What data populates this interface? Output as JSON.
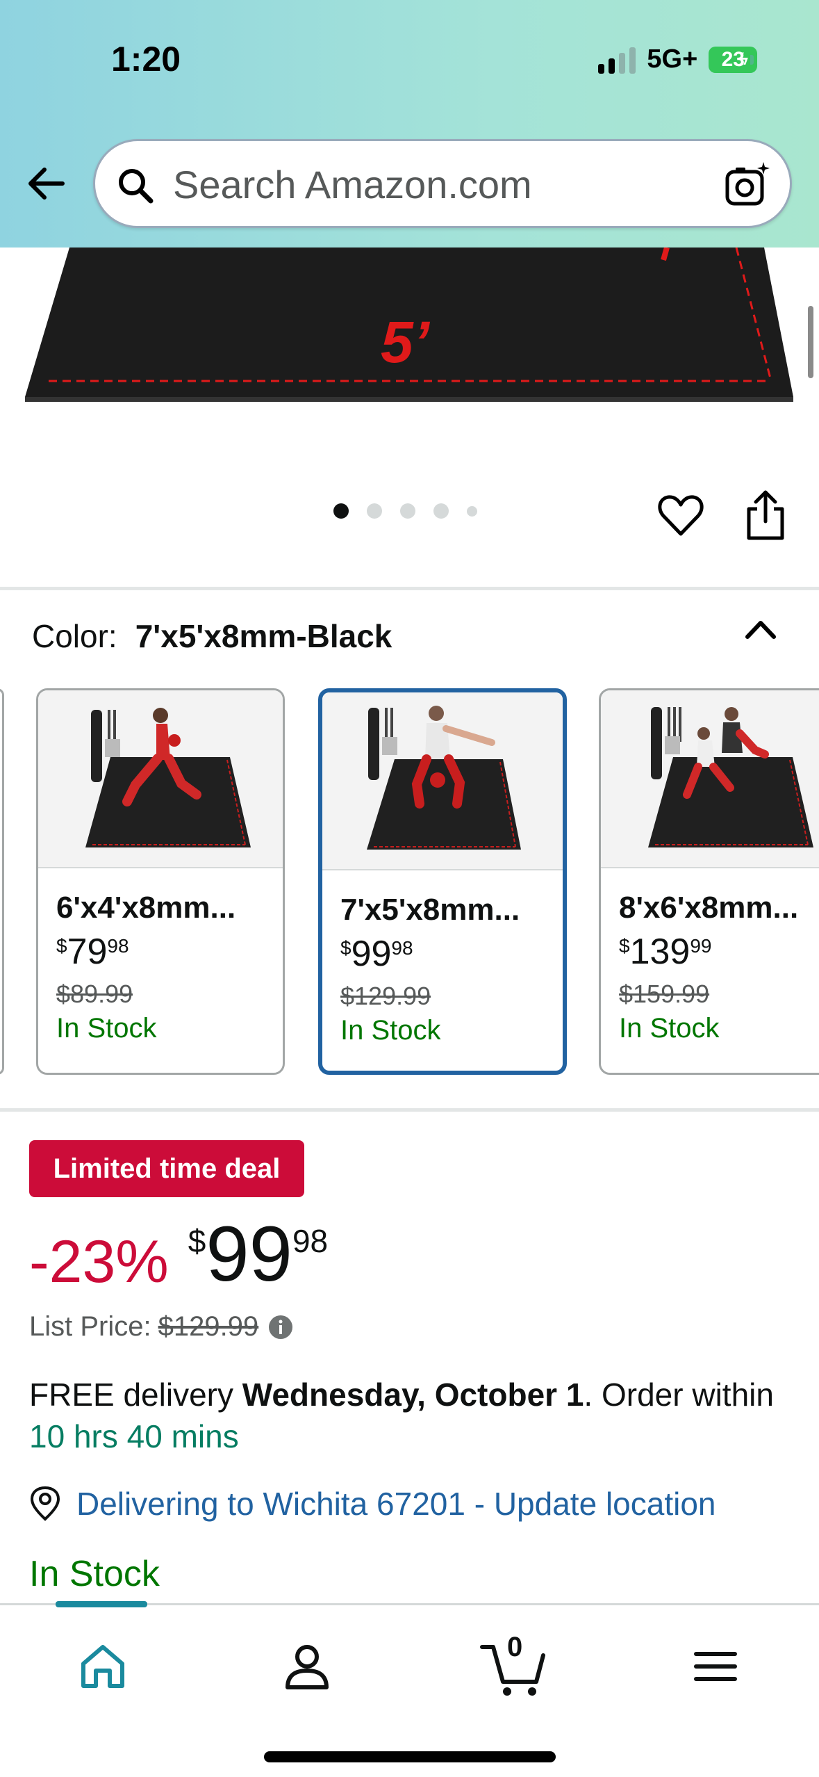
{
  "status_bar": {
    "time": "1:20",
    "network": "5G+",
    "battery": "23"
  },
  "search": {
    "placeholder": "Search Amazon.com"
  },
  "product_image": {
    "dimension_label": "5’"
  },
  "carousel": {
    "dot_count": 5,
    "active_index": 0
  },
  "color": {
    "label": "Color:",
    "value": "7'x5'x8mm-Black"
  },
  "variants": [
    {
      "title": "6'x4'x8mm...",
      "currency": "$",
      "price_whole": "79",
      "price_cents": "98",
      "list_price": "$89.99",
      "stock": "In Stock",
      "selected": false
    },
    {
      "title": "7'x5'x8mm...",
      "currency": "$",
      "price_whole": "99",
      "price_cents": "98",
      "list_price": "$129.99",
      "stock": "In Stock",
      "selected": true
    },
    {
      "title": "8'x6'x8mm...",
      "currency": "$",
      "price_whole": "139",
      "price_cents": "99",
      "list_price": "$159.99",
      "stock": "In Stock",
      "selected": false
    }
  ],
  "deal": {
    "badge": "Limited time deal",
    "discount": "-23%",
    "currency": "$",
    "price_whole": "99",
    "price_cents": "98",
    "list_price_label": "List Price:",
    "list_price": "$129.99"
  },
  "delivery": {
    "prefix": "FREE delivery ",
    "date": "Wednesday, October 1",
    "middle": ". Order within ",
    "countdown": "10 hrs 40 mins"
  },
  "location": {
    "link": "Delivering to Wichita 67201 - Update location"
  },
  "availability": "In Stock",
  "cart": {
    "count": "0"
  },
  "colors": {
    "accent": "#2162a1",
    "deal_red": "#cc0c39",
    "stock_green": "#007600",
    "teal": "#067d62"
  }
}
